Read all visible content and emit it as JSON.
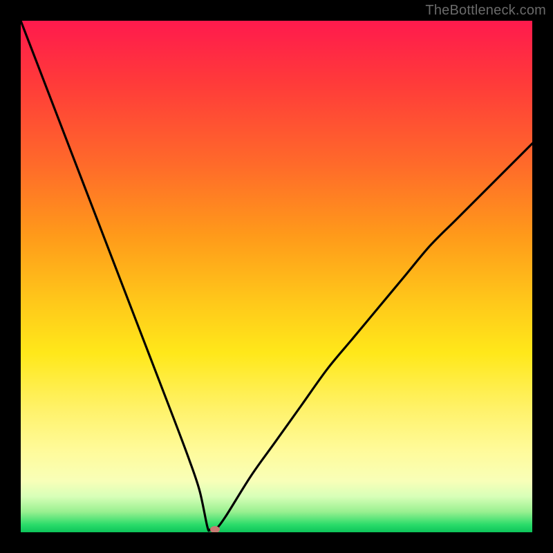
{
  "attribution": "TheBottleneck.com",
  "colors": {
    "frame_bg": "#000000",
    "dot": "#c77a72",
    "gradient_top": "#ff1a4d",
    "gradient_bottom": "#0cc45a",
    "curve": "#000000"
  },
  "chart_data": {
    "type": "line",
    "title": "",
    "xlabel": "",
    "ylabel": "",
    "xlim": [
      0,
      100
    ],
    "ylim": [
      0,
      100
    ],
    "grid": false,
    "legend": "none",
    "series": [
      {
        "name": "bottleneck-curve",
        "x": [
          0,
          5,
          10,
          15,
          20,
          25,
          30,
          33,
          35,
          36.5,
          37,
          38,
          40,
          45,
          50,
          55,
          60,
          65,
          70,
          75,
          80,
          85,
          90,
          95,
          100
        ],
        "y": [
          100,
          87,
          74,
          61,
          48,
          35,
          22,
          14,
          8,
          1,
          0.5,
          0.5,
          3,
          11,
          18,
          25,
          32,
          38,
          44,
          50,
          56,
          61,
          66,
          71,
          76
        ]
      }
    ],
    "annotations": [
      {
        "name": "optimum-dot",
        "x": 38,
        "y": 0.5
      }
    ],
    "background": {
      "type": "vertical-gradient",
      "stops": [
        {
          "pos": 0,
          "color": "#ff1a4d"
        },
        {
          "pos": 50,
          "color": "#ffc81a"
        },
        {
          "pos": 85,
          "color": "#fffb9a"
        },
        {
          "pos": 100,
          "color": "#0cc45a"
        }
      ]
    }
  }
}
